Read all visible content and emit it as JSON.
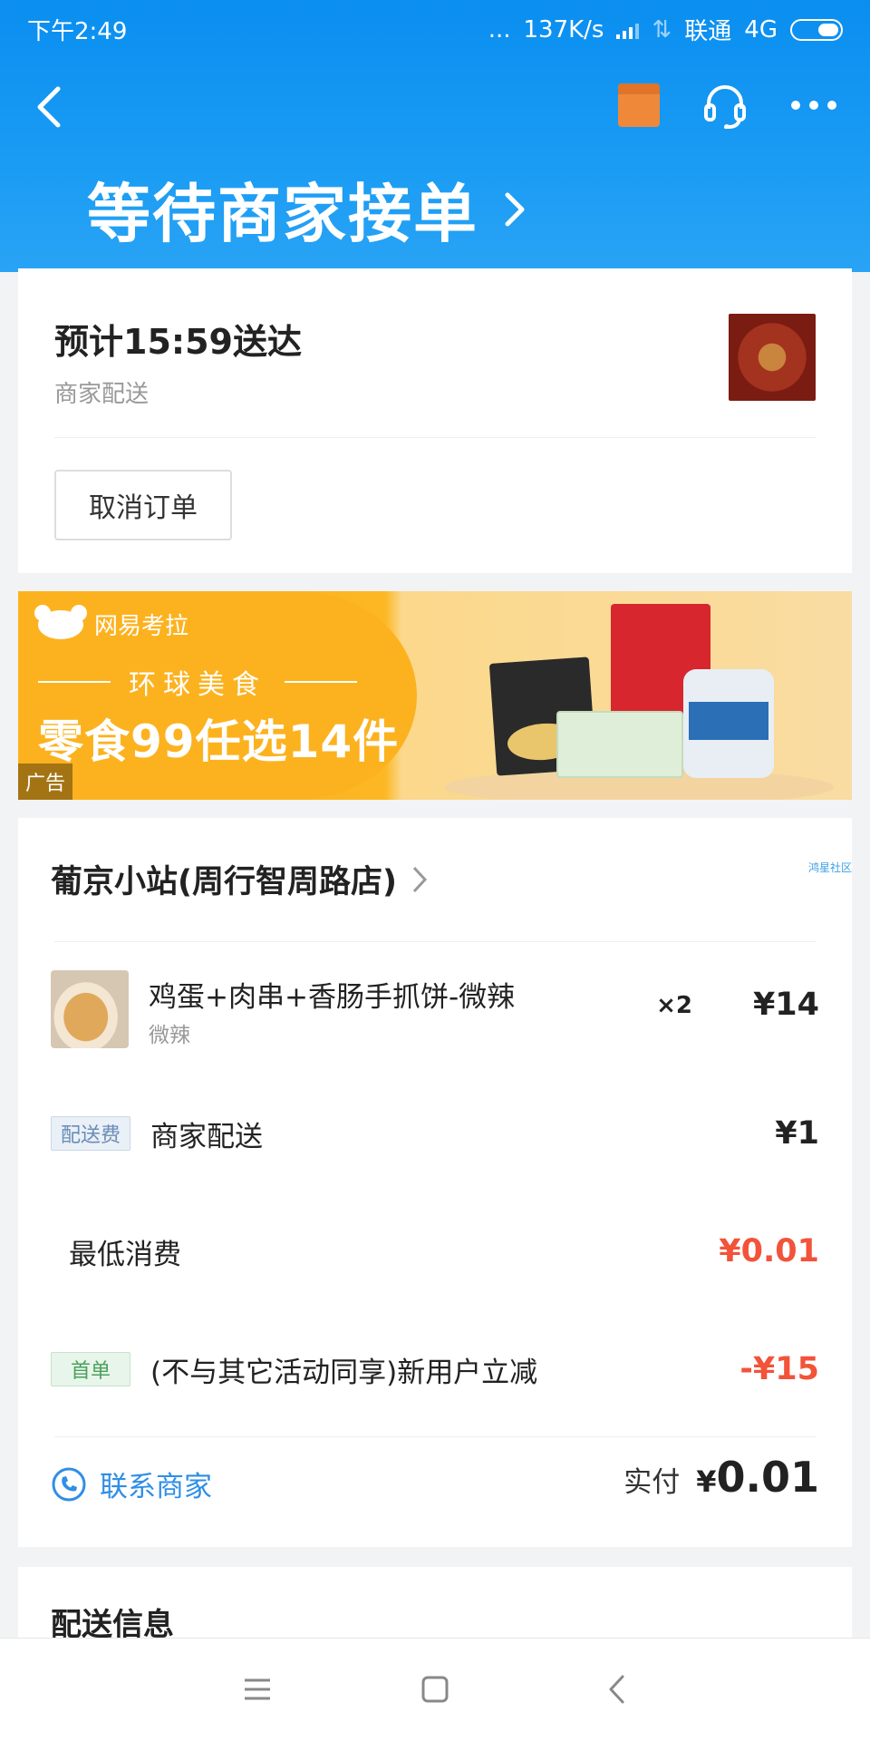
{
  "status_bar": {
    "time": "下午2:49",
    "dots": "...",
    "speed": "137K/s",
    "carrier": "联通",
    "network": "4G"
  },
  "nav": {
    "icons": [
      "back-icon",
      "package-icon",
      "customer-service-icon",
      "more-icon"
    ]
  },
  "order_status": {
    "title": "等待商家接单"
  },
  "delivery": {
    "eta": "预计15:59送达",
    "type": "商家配送",
    "cancel_label": "取消订单"
  },
  "ad": {
    "brand": "网易考拉",
    "subtitle": "环球美食",
    "headline": "零食99任选14件",
    "tag": "广告"
  },
  "order": {
    "shop_name": "葡京小站(周行智周路店)",
    "watermark": "鸿星社区",
    "item": {
      "name": "鸡蛋+肉串+香肠手抓饼-微辣",
      "spec": "微辣",
      "qty": "×2",
      "price": "¥14"
    },
    "fee": {
      "badge": "配送费",
      "label": "商家配送",
      "amount": "¥1"
    },
    "minimum": {
      "label": "最低消费",
      "amount": "¥0.01"
    },
    "discount": {
      "badge": "首单",
      "label": "(不与其它活动同享)新用户立减",
      "amount": "-¥15"
    },
    "contact_label": "联系商家",
    "pay_label": "实付",
    "pay_currency": "¥",
    "pay_value": "0.01"
  },
  "delivery_info": {
    "title": "配送信息"
  },
  "colors": {
    "header_blue": "#0a8ef0",
    "accent_red": "#f2533a",
    "link_blue": "#2f8ee6",
    "ad_orange": "#fcb21f"
  }
}
